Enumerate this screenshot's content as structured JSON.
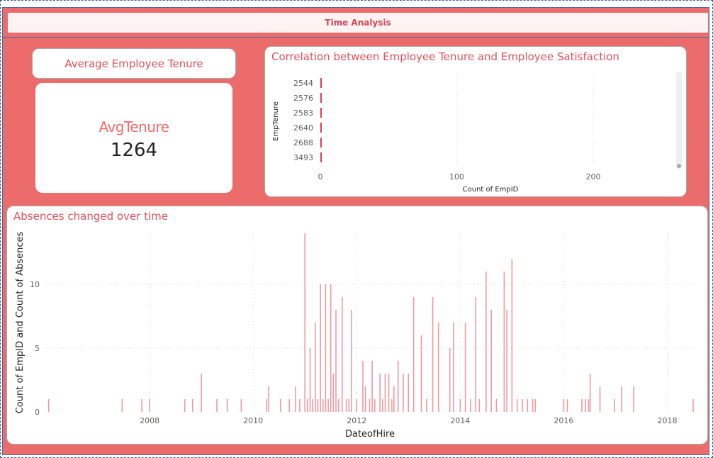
{
  "page": {
    "title": "Time Analysis"
  },
  "kpi": {
    "title": "Average Employee Tenure",
    "label": "AvgTenure",
    "value": "1264"
  },
  "chart_data": [
    {
      "type": "bar",
      "orientation": "horizontal",
      "title": "Correlation between Employee Tenure and Employee Satisfaction",
      "xlabel": "Count of EmpID",
      "ylabel": "EmpTenure",
      "categories": [
        "2544",
        "2576",
        "2583",
        "2640",
        "2688",
        "3493"
      ],
      "values": [
        1,
        1,
        1,
        1,
        1,
        1
      ],
      "xlim": [
        0,
        240
      ],
      "xticks": [
        "0",
        "100",
        "200"
      ],
      "xtick_values": [
        0,
        100,
        200
      ],
      "grid": true,
      "color": "#d9404a"
    },
    {
      "type": "bar",
      "title": "Absences changed over time",
      "xlabel": "DateofHire",
      "ylabel": "Count of EmpID and Count of Absences",
      "ylim": [
        0,
        14
      ],
      "yticks": [
        "0",
        "5",
        "10"
      ],
      "ytick_values": [
        0,
        5,
        10
      ],
      "xlim": [
        2006.0,
        2018.5
      ],
      "xticks": [
        "2008",
        "2010",
        "2012",
        "2014",
        "2016",
        "2018"
      ],
      "xtick_values": [
        2008,
        2010,
        2012,
        2014,
        2016,
        2018
      ],
      "grid": true,
      "color": "#ee9aa0",
      "x": [
        2006.05,
        2007.47,
        2007.85,
        2008.0,
        2008.68,
        2008.83,
        2009.0,
        2009.3,
        2009.5,
        2009.77,
        2010.26,
        2010.3,
        2010.53,
        2010.7,
        2010.82,
        2010.9,
        2011.0,
        2011.05,
        2011.1,
        2011.15,
        2011.2,
        2011.25,
        2011.3,
        2011.35,
        2011.4,
        2011.45,
        2011.5,
        2011.55,
        2011.6,
        2011.65,
        2011.72,
        2011.8,
        2011.85,
        2011.9,
        2012.0,
        2012.12,
        2012.17,
        2012.25,
        2012.3,
        2012.35,
        2012.45,
        2012.5,
        2012.55,
        2012.62,
        2012.68,
        2012.72,
        2012.8,
        2012.9,
        2013.0,
        2013.1,
        2013.25,
        2013.35,
        2013.47,
        2013.58,
        2013.8,
        2013.87,
        2014.0,
        2014.1,
        2014.2,
        2014.3,
        2014.37,
        2014.5,
        2014.6,
        2014.7,
        2014.85,
        2014.9,
        2015.0,
        2015.1,
        2015.2,
        2015.3,
        2015.4,
        2015.45,
        2016.0,
        2016.07,
        2016.35,
        2016.42,
        2016.48,
        2016.51,
        2016.7,
        2016.98,
        2017.12,
        2017.35,
        2018.5
      ],
      "values": [
        1,
        1,
        1,
        1,
        1,
        1,
        3,
        1,
        1,
        1,
        1,
        2,
        1,
        1,
        2,
        1,
        14,
        1,
        5,
        1,
        7,
        1,
        10,
        1,
        10,
        1,
        10,
        3,
        8,
        1,
        9,
        1,
        1,
        8,
        1,
        4,
        2,
        1,
        4,
        1,
        3,
        1,
        3,
        3,
        1,
        2,
        4,
        3,
        3,
        9,
        6,
        1,
        9,
        7,
        5,
        7,
        1,
        7,
        1,
        9,
        1,
        11,
        8,
        1,
        11,
        8,
        12,
        1,
        1,
        1,
        1,
        1,
        1,
        1,
        1,
        1,
        1,
        3,
        2,
        1,
        2,
        2,
        1
      ]
    }
  ]
}
